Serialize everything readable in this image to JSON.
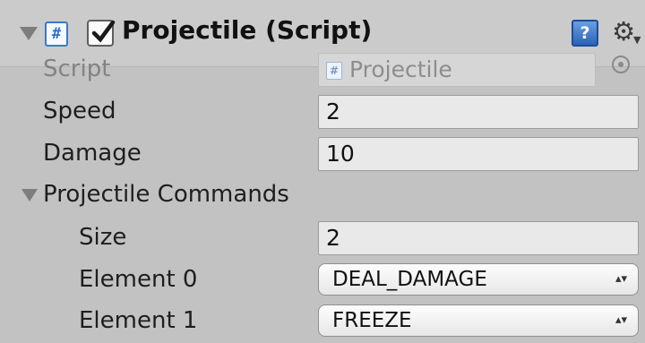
{
  "component": {
    "title": "Projectile (Script)",
    "script_icon": "script-icon",
    "enabled": true
  },
  "fields": {
    "script": {
      "label": "Script",
      "value": "Projectile"
    },
    "speed": {
      "label": "Speed",
      "value": "2"
    },
    "damage": {
      "label": "Damage",
      "value": "10"
    }
  },
  "commands": {
    "label": "Projectile Commands",
    "size": {
      "label": "Size",
      "value": "2"
    },
    "elements": [
      {
        "label": "Element 0",
        "value": "DEAL_DAMAGE"
      },
      {
        "label": "Element 1",
        "value": "FREEZE"
      }
    ]
  },
  "icons": {
    "help": "?",
    "gear": "⚙",
    "script_glyph": "#",
    "dropdown_arrows": "▴▾"
  }
}
